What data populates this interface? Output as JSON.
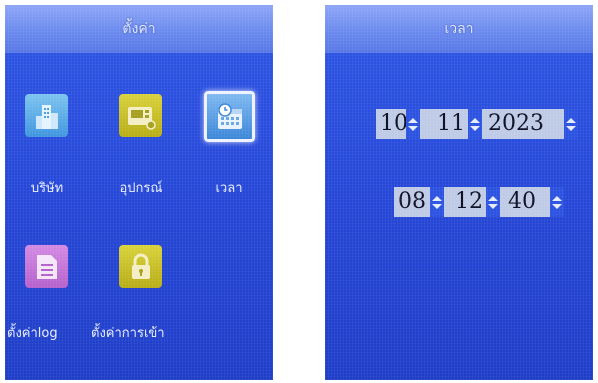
{
  "left_screen": {
    "title": "ตั้งค่า",
    "items": [
      {
        "label": "บริษัท",
        "icon": "building-icon"
      },
      {
        "label": "อุปกรณ์",
        "icon": "device-icon"
      },
      {
        "label": "เวลา",
        "icon": "calendar-clock-icon",
        "selected": true
      },
      {
        "label": "ตั้งค่าlog",
        "icon": "document-icon"
      },
      {
        "label": "ตั้งค่าการเข้า",
        "icon": "lock-icon"
      }
    ]
  },
  "right_screen": {
    "title": "เวลา",
    "date": {
      "day": "10",
      "month": "11",
      "year": "2023"
    },
    "time": {
      "hour": "08",
      "minute": "12",
      "second": "40"
    }
  },
  "colors": {
    "screen_bg": "#2a4ee0",
    "field_bg": "#bfcbe6",
    "accent": "#2b52e0"
  }
}
